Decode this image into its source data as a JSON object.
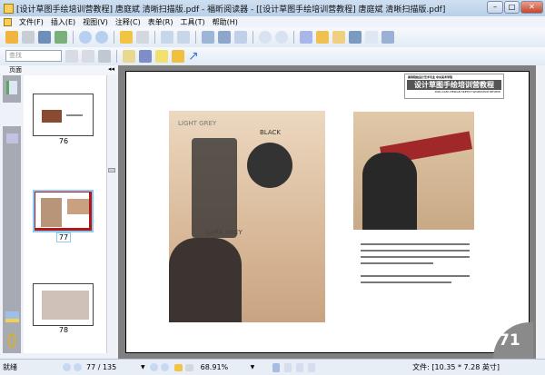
{
  "window": {
    "title": "[设计草图手绘培训营教程] 唐庭斌 清晰扫描版.pdf - 福昕阅读器 - [[设计草图手绘培训营教程] 唐庭斌 清晰扫描版.pdf]"
  },
  "menu": [
    "文件(F)",
    "插入(E)",
    "视图(V)",
    "注释(C)",
    "表单(R)",
    "工具(T)",
    "帮助(H)"
  ],
  "toolbar": {
    "search_placeholder": "查找"
  },
  "panel": {
    "title": "页面",
    "thumbnails": [
      {
        "label": "76"
      },
      {
        "label": "77",
        "selected": true
      },
      {
        "label": "78"
      }
    ]
  },
  "document": {
    "header_small": "高等院校设计艺术专业  中央美术学院",
    "book_title": "设计草图手绘培训营教程",
    "header_sub": "DOD-CAFA DESIGN SKETCH WORKSHOP REVIEW",
    "page_number": "71",
    "photo_labels": [
      "LIGHT GREY",
      "BLACK",
      "DARK GREY"
    ]
  },
  "status": {
    "ready": "就绪",
    "page": "77 / 135",
    "zoom": "68.91%",
    "file_size": "文件: [10.35 * 7.28 英寸]"
  }
}
